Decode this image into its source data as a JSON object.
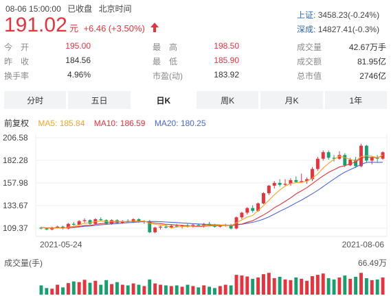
{
  "header": {
    "datetime": "08-06 15:00:00",
    "status": "已收盘",
    "timezone": "北京时间",
    "price": "191.02",
    "currency": "元",
    "change": "+6.46",
    "change_pct": "(+3.50%)",
    "up_arrow_icon": "arrow-up-icon"
  },
  "indices": [
    {
      "name": "上证:",
      "value": "3458.23(-0.24%)"
    },
    {
      "name": "深成:",
      "value": "14827.41(-0.3%)"
    }
  ],
  "stats": {
    "col1": [
      {
        "label": "今　开",
        "value": "195.00",
        "color": "#e8323c"
      },
      {
        "label": "昨　收",
        "value": "184.56",
        "color": "#333333"
      },
      {
        "label": "换手率",
        "value": "4.96%",
        "color": "#333333"
      }
    ],
    "col2": [
      {
        "label": "最　高",
        "value": "198.50",
        "color": "#e8323c"
      },
      {
        "label": "最　低",
        "value": "185.90",
        "color": "#e8323c"
      },
      {
        "label": "市盈(动)",
        "value": "183.92",
        "color": "#333333"
      }
    ],
    "col3": [
      {
        "label": "成交量",
        "value": "42.67万手"
      },
      {
        "label": "成交额",
        "value": "81.95亿"
      },
      {
        "label": "总市值",
        "value": "2746亿"
      }
    ]
  },
  "tabs": [
    {
      "label": "分时",
      "active": false
    },
    {
      "label": "五日",
      "active": false
    },
    {
      "label": "日K",
      "active": true
    },
    {
      "label": "周K",
      "active": false
    },
    {
      "label": "月K",
      "active": false
    },
    {
      "label": "1年",
      "active": false
    }
  ],
  "ma_legend": {
    "adjust": "前复权",
    "ma5": "MA5: 185.84",
    "ma10": "MA10: 186.59",
    "ma20": "MA20: 180.25",
    "colors": {
      "ma5": "#f5a623",
      "ma10": "#e8323c",
      "ma20": "#4a66d6"
    }
  },
  "chart_data": {
    "type": "candlestick",
    "y_ticks": [
      "206.58",
      "182.28",
      "157.98",
      "133.67",
      "109.37"
    ],
    "ylim": [
      100,
      210
    ],
    "x_labels": [
      "2021-05-24",
      "2021-08-06"
    ],
    "up_color": "#e8323c",
    "down_color": "#15a06e",
    "candles": [
      [
        110,
        111,
        108,
        109
      ],
      [
        109,
        110,
        107,
        108
      ],
      [
        108,
        111,
        107,
        110
      ],
      [
        110,
        112,
        109,
        111
      ],
      [
        111,
        112,
        108,
        109
      ],
      [
        109,
        115,
        108,
        114
      ],
      [
        114,
        116,
        112,
        113
      ],
      [
        113,
        118,
        112,
        117
      ],
      [
        117,
        120,
        115,
        118
      ],
      [
        118,
        119,
        113,
        114
      ],
      [
        114,
        120,
        113,
        119
      ],
      [
        119,
        121,
        117,
        118
      ],
      [
        118,
        119,
        113,
        114
      ],
      [
        114,
        119,
        113,
        118
      ],
      [
        118,
        119,
        114,
        115
      ],
      [
        115,
        118,
        114,
        117
      ],
      [
        117,
        119,
        115,
        116
      ],
      [
        116,
        120,
        115,
        119
      ],
      [
        119,
        120,
        115,
        116
      ],
      [
        116,
        118,
        114,
        117
      ],
      [
        117,
        118,
        104,
        105
      ],
      [
        105,
        111,
        104,
        110
      ],
      [
        110,
        112,
        108,
        111
      ],
      [
        111,
        113,
        109,
        110
      ],
      [
        110,
        113,
        109,
        112
      ],
      [
        112,
        114,
        110,
        111
      ],
      [
        111,
        113,
        109,
        112
      ],
      [
        112,
        114,
        110,
        111
      ],
      [
        111,
        114,
        110,
        113
      ],
      [
        113,
        114,
        111,
        112
      ],
      [
        112,
        115,
        110,
        114
      ],
      [
        114,
        116,
        112,
        113
      ],
      [
        113,
        114,
        110,
        111
      ],
      [
        111,
        113,
        110,
        112
      ],
      [
        112,
        114,
        111,
        113
      ],
      [
        113,
        114,
        108,
        109
      ],
      [
        109,
        122,
        108,
        121
      ],
      [
        121,
        127,
        119,
        126
      ],
      [
        126,
        132,
        124,
        131
      ],
      [
        131,
        134,
        126,
        128
      ],
      [
        128,
        137,
        127,
        136
      ],
      [
        136,
        148,
        135,
        147
      ],
      [
        147,
        156,
        145,
        155
      ],
      [
        155,
        160,
        152,
        158
      ],
      [
        158,
        162,
        154,
        156
      ],
      [
        156,
        162,
        155,
        157
      ],
      [
        157,
        163,
        155,
        161
      ],
      [
        161,
        165,
        158,
        159
      ],
      [
        159,
        168,
        158,
        160
      ],
      [
        160,
        164,
        157,
        162
      ],
      [
        162,
        175,
        160,
        173
      ],
      [
        173,
        186,
        171,
        184
      ],
      [
        184,
        193,
        182,
        191
      ],
      [
        191,
        193,
        183,
        185
      ],
      [
        185,
        188,
        181,
        184
      ],
      [
        184,
        192,
        183,
        188
      ],
      [
        188,
        190,
        175,
        177
      ],
      [
        177,
        185,
        176,
        183
      ],
      [
        183,
        186,
        174,
        176
      ],
      [
        176,
        200,
        175,
        198
      ],
      [
        198,
        199,
        180,
        182
      ],
      [
        182,
        187,
        178,
        185
      ],
      [
        185,
        188,
        180,
        184
      ],
      [
        184,
        192,
        183,
        191
      ]
    ],
    "ma5": [
      110,
      109.4,
      109.4,
      109.6,
      109.4,
      110.4,
      111.4,
      112.8,
      114.6,
      115.2,
      116.4,
      117.2,
      116.6,
      116.6,
      116.8,
      116.4,
      116,
      117,
      116.6,
      117,
      114.6,
      113.6,
      112.6,
      112.6,
      109.6,
      110.8,
      111.2,
      111.2,
      111.8,
      111.8,
      112.2,
      112.6,
      112.6,
      112.6,
      112.6,
      112.2,
      115.2,
      118.2,
      121.4,
      123,
      128.4,
      133.6,
      139.4,
      145.2,
      150.4,
      154.6,
      157.4,
      158.2,
      158.6,
      159.8,
      163,
      167.6,
      174,
      179,
      183.4,
      186.8,
      185.2,
      183.4,
      181.6,
      186.4,
      187.2,
      186.8,
      185,
      188
    ],
    "ma10": [
      110,
      109.7,
      109.7,
      109.9,
      109.6,
      109.9,
      110.4,
      111.3,
      112.2,
      112.3,
      113.4,
      114.3,
      114.7,
      115.6,
      116,
      116.4,
      116.6,
      116.8,
      116.9,
      116.8,
      115.6,
      114.8,
      114.3,
      113.6,
      113.3,
      112.7,
      112.4,
      112,
      111.4,
      111.2,
      111.5,
      111.9,
      112,
      112.1,
      112.3,
      112.2,
      113.1,
      113.8,
      115.8,
      117.3,
      120.5,
      123.6,
      127.1,
      131.3,
      134.5,
      138.2,
      141.9,
      146.2,
      149.5,
      153,
      157.2,
      161.5,
      165.6,
      169.3,
      172.2,
      175.1,
      176.5,
      178.7,
      180.4,
      185,
      185.6,
      185.3,
      185.4,
      187.3
    ],
    "ma20": [
      110,
      109.7,
      109.6,
      109.9,
      109.7,
      109.9,
      110.2,
      110.7,
      111.4,
      111.7,
      112.3,
      113,
      113.4,
      113.9,
      114.3,
      114.8,
      115.2,
      115.7,
      116.1,
      116.2,
      116.5,
      116.5,
      116.3,
      116,
      115.7,
      115.4,
      115,
      114.6,
      114.2,
      113.9,
      113.6,
      113.3,
      113.1,
      112.9,
      112.8,
      112.5,
      112.9,
      113.6,
      114.7,
      115.6,
      117.2,
      119.1,
      121.5,
      124.5,
      127.5,
      130.3,
      133.3,
      136.5,
      139.6,
      142.9,
      146.4,
      150,
      154.1,
      158.2,
      162.2,
      166.1,
      169.6,
      172.3,
      174.9,
      178,
      180,
      180.3,
      180,
      180.25
    ]
  },
  "volume": {
    "label": "成交量(手)",
    "max_label": "66.49万",
    "max": 66.49,
    "values": [
      28,
      20,
      18,
      30,
      22,
      35,
      40,
      38,
      45,
      36,
      42,
      30,
      44,
      32,
      38,
      30,
      28,
      34,
      30,
      26,
      46,
      34,
      30,
      28,
      26,
      28,
      24,
      30,
      26,
      22,
      28,
      24,
      20,
      26,
      30,
      28,
      60,
      58,
      55,
      48,
      52,
      62,
      66,
      50,
      54,
      46,
      44,
      52,
      48,
      42,
      56,
      60,
      64,
      50,
      46,
      52,
      58,
      48,
      54,
      66,
      50,
      44,
      46,
      52
    ]
  }
}
